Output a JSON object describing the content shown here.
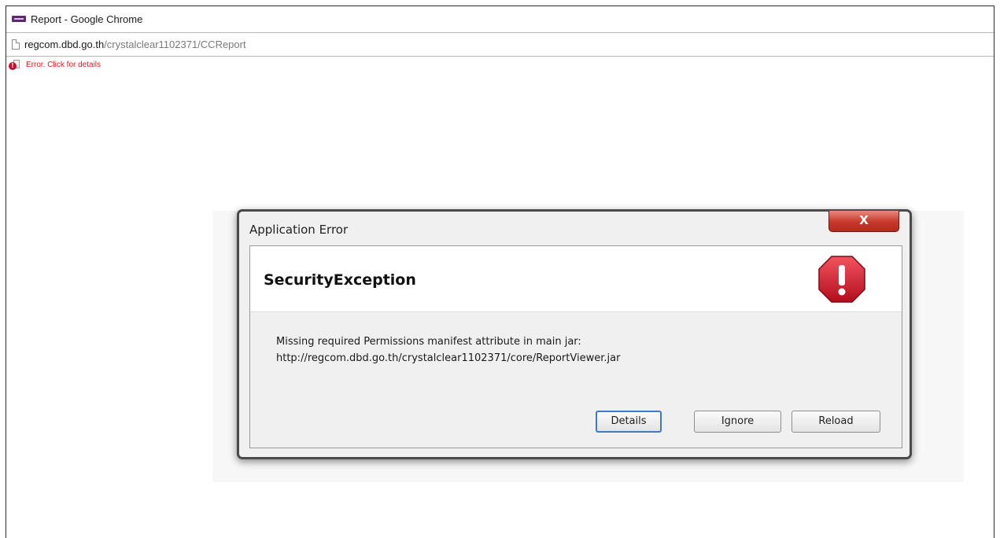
{
  "window": {
    "title": "Report - Google Chrome"
  },
  "address": {
    "host": "regcom.dbd.go.th",
    "path": "/crystalclear1102371/CCReport"
  },
  "page": {
    "error_text": "Error. Click for details"
  },
  "dialog": {
    "title": "Application Error",
    "close_label": "X",
    "exception": "SecurityException",
    "message_line1": "Missing required Permissions manifest attribute in main jar:",
    "message_line2": "http://regcom.dbd.go.th/crystalclear1102371/core/ReportViewer.jar",
    "buttons": {
      "details": "Details",
      "ignore": "Ignore",
      "reload": "Reload"
    },
    "icon": "stop-warning-icon"
  },
  "colors": {
    "error_text": "#d41e1e",
    "close_button": "#c8372b",
    "stop_icon": "#c8102e",
    "default_button_border": "#3d7bc4"
  }
}
